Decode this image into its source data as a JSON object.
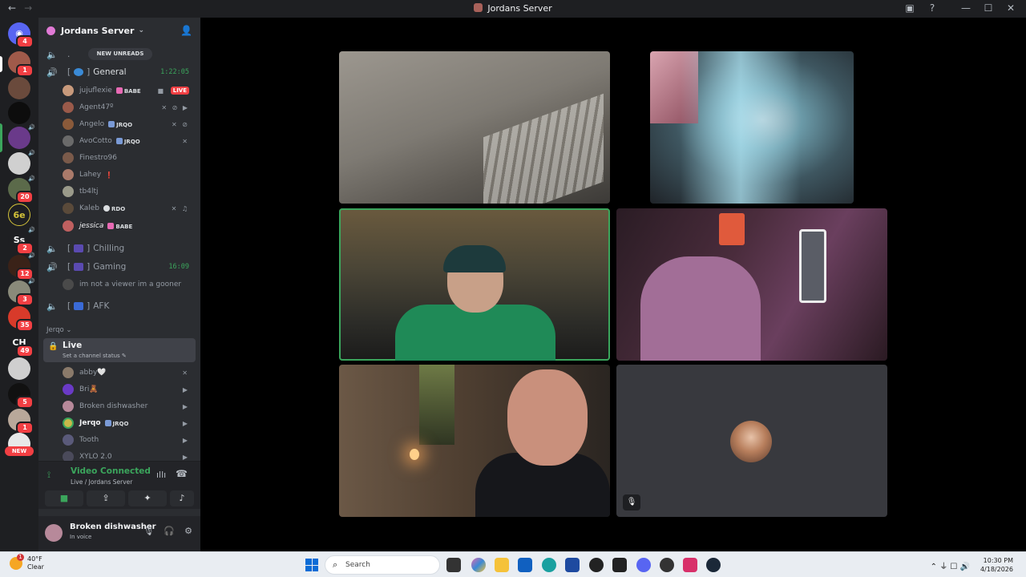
{
  "window": {
    "title": "Jordans Server",
    "back": "←",
    "forward": "→"
  },
  "titlebar_icons": [
    "inbox-icon",
    "help-icon",
    "minimize-icon",
    "maximize-icon",
    "close-icon"
  ],
  "titlebar_glyphs": {
    "inbox": "▣",
    "help": "?",
    "minimize": "—",
    "maximize": "☐",
    "close": "✕"
  },
  "rail": {
    "badges": [
      "4",
      "1",
      "20",
      "2",
      "12",
      "3",
      "35",
      "49",
      "5",
      "1"
    ],
    "texts": [
      "Ss",
      "CH"
    ],
    "new_label": "NEW"
  },
  "server": {
    "name": "Jordans Server",
    "chevron": "⌄",
    "invite": "👤"
  },
  "new_unreads": "NEW UNREADS",
  "channels": [
    {
      "name": ".",
      "active": false,
      "time": ""
    },
    {
      "name": "General",
      "active": true,
      "time": "1:22:05"
    },
    {
      "name": "Chilling",
      "active": false,
      "time": ""
    },
    {
      "name": "Gaming",
      "active": true,
      "time": "16:09"
    },
    {
      "name": "AFK",
      "active": false,
      "time": ""
    }
  ],
  "brackets": {
    "open": "[",
    "close": "]"
  },
  "general_users": [
    {
      "name": "jujuflexie",
      "tag": "BABE",
      "badge": "LIVE"
    },
    {
      "name": "Agent47º",
      "tag": "",
      "icons": "✕ ⊘ ▶"
    },
    {
      "name": "Angelo",
      "tag": "JRQO",
      "icons": "✕ ⊘"
    },
    {
      "name": "AvoCotto",
      "tag": "JRQO",
      "icons": "✕"
    },
    {
      "name": "Finestro96",
      "tag": "",
      "icons": ""
    },
    {
      "name": "Lahey",
      "tag": "",
      "icons": ""
    },
    {
      "name": "tb4ltj",
      "tag": "",
      "icons": ""
    },
    {
      "name": "Kaleb",
      "tag": "RDO",
      "icons": "✕ ♫"
    },
    {
      "name": "jessica",
      "tag": "BABE",
      "icons": ""
    }
  ],
  "gaming_user": {
    "name": "im not a viewer im a gooner"
  },
  "category": "Jerqo ⌄",
  "live_channel": {
    "name": "Live",
    "status": "Set a channel status ✎",
    "lock": "🔒"
  },
  "live_users": [
    {
      "name": "abby🤍",
      "icons": "✕"
    },
    {
      "name": "Bri🧸",
      "icons": "▶"
    },
    {
      "name": "Broken dishwasher",
      "icons": "▶"
    },
    {
      "name": "Jerqo",
      "tag": "JRQO",
      "icons": "▶"
    },
    {
      "name": "Tooth",
      "icons": "▶"
    },
    {
      "name": "XYLO 2.0",
      "icons": "▶"
    }
  ],
  "voice": {
    "status": "Video Connected",
    "location": "Live / Jordans Server",
    "buttons": [
      "camera-icon",
      "screen-share-icon",
      "activities-icon",
      "soundboard-icon"
    ],
    "glyphs": {
      "signal": "⟟",
      "wave": "ıllı",
      "hangup": "☎",
      "camera": "■",
      "share": "⇪",
      "activity": "✦",
      "sound": "♪"
    }
  },
  "user_panel": {
    "name": "Broken dishwasher",
    "status": "In voice",
    "glyphs": {
      "mic": "🎙",
      "headset": "🎧",
      "settings": "⚙"
    }
  },
  "tiles": [
    {
      "id": "ceiling-cam"
    },
    {
      "id": "blonde-woman"
    },
    {
      "id": "green-shirt-man"
    },
    {
      "id": "purple-room-woman"
    },
    {
      "id": "headset-man"
    },
    {
      "id": "avatar-only"
    }
  ],
  "taskbar": {
    "weather_temp": "40°F",
    "weather_desc": "Clear",
    "weather_badge": "1",
    "search_placeholder": "Search",
    "search_glyph": "⌕",
    "time": "10:30 PM",
    "date": "4/18/2026",
    "tray_glyphs": "⌃ ⏚ ☐ 🔊"
  },
  "colors": {
    "accent_green": "#3ba55c",
    "live_red": "#f23f43",
    "sidebar": "#2b2d31",
    "rail": "#1e1f22"
  }
}
